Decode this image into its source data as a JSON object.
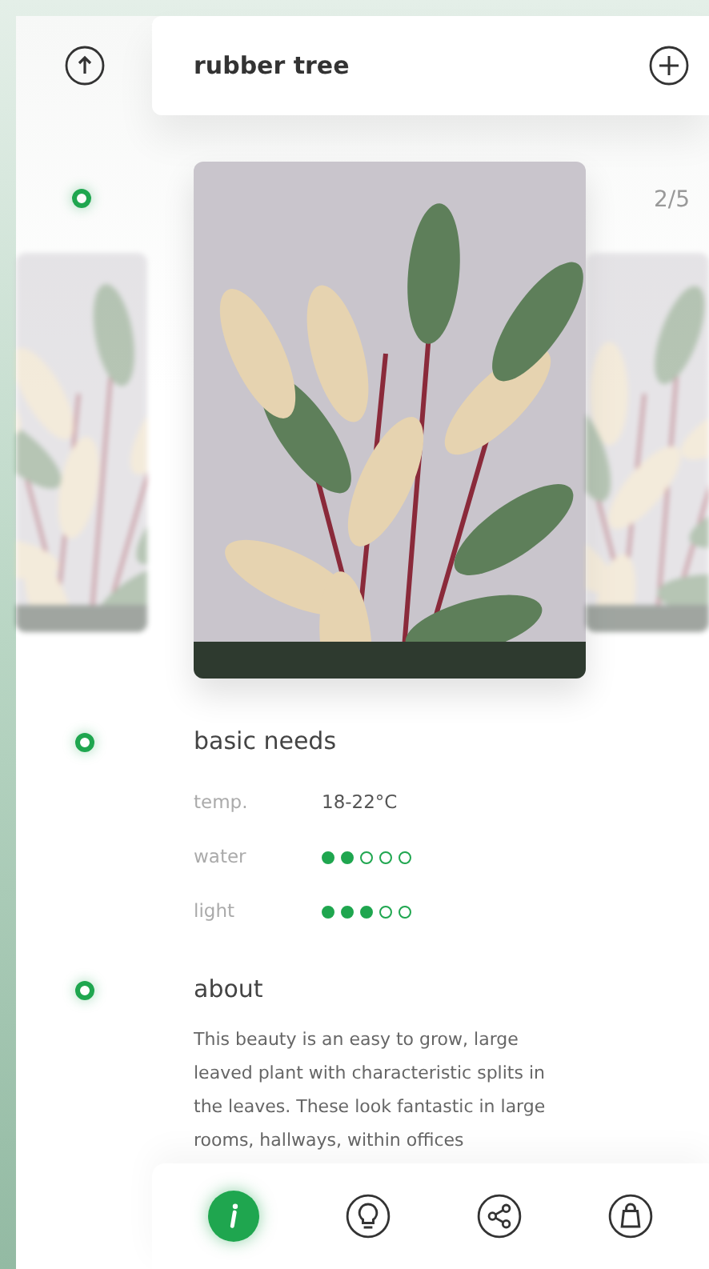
{
  "header": {
    "title": "rubber tree"
  },
  "carousel": {
    "counter": "2/5",
    "slides": [
      {
        "selected": false
      },
      {
        "selected": true
      },
      {
        "selected": false
      }
    ]
  },
  "basic_needs": {
    "title": "basic needs",
    "rows": [
      {
        "kind": "text",
        "label": "temp.",
        "value": "18-22°C"
      },
      {
        "kind": "dots",
        "label": "water",
        "stars": 2
      },
      {
        "kind": "dots",
        "label": "light",
        "stars": 3
      }
    ]
  },
  "about": {
    "title": "about",
    "text": "This beauty is an easy to grow, large leaved plant with characteristic splits in the leaves. These look fantastic in large rooms, hallways, within offices"
  },
  "nav": [
    {
      "kind": "info",
      "selected": true
    },
    {
      "kind": "bulb",
      "selected": false
    },
    {
      "kind": "share",
      "selected": false
    },
    {
      "kind": "bag",
      "selected": false
    }
  ]
}
